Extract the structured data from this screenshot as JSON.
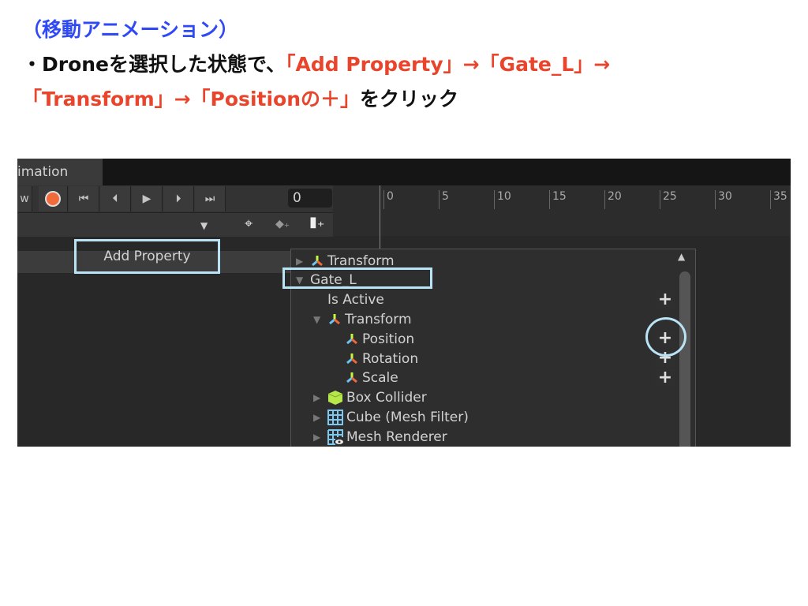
{
  "slide": {
    "heading": "（移動アニメーション）",
    "line2_black": "・Droneを選択した状態で、",
    "line2_red": "「Add Property」→「Gate_L」→",
    "line3_red": "「Transform」→「Positionの＋」",
    "line3_black": "をクリック"
  },
  "colors": {
    "heading": "#2f49f5",
    "highlight": "#e8452c",
    "callout": "#b8e4f5"
  },
  "window": {
    "tab": "imation",
    "preview_partial": "w",
    "frame": "0"
  },
  "toolbar": {
    "record": "record-icon",
    "first": "⏮",
    "prev": "⏴",
    "play": "▶",
    "next": "⏵",
    "last": "⏭"
  },
  "ruler": [
    "0",
    "5",
    "10",
    "15",
    "20",
    "25",
    "30",
    "35"
  ],
  "add_property": "Add Property",
  "popup": {
    "items": [
      {
        "label": "Transform",
        "indent": 0,
        "arrow": "▶",
        "icon": "transform-icon"
      },
      {
        "label": "Gate_L",
        "indent": 0,
        "arrow": "▼",
        "icon": ""
      },
      {
        "label": "Is Active",
        "indent": 1,
        "arrow": "",
        "icon": "",
        "plus": true
      },
      {
        "label": "Transform",
        "indent": 1,
        "arrow": "▼",
        "icon": "transform-icon"
      },
      {
        "label": "Position",
        "indent": 2,
        "arrow": "",
        "icon": "transform-icon",
        "plus": true
      },
      {
        "label": "Rotation",
        "indent": 2,
        "arrow": "",
        "icon": "transform-icon",
        "plus": true
      },
      {
        "label": "Scale",
        "indent": 2,
        "arrow": "",
        "icon": "transform-icon",
        "plus": true
      },
      {
        "label": "Box Collider",
        "indent": 1,
        "arrow": "▶",
        "icon": "box-collider-icon"
      },
      {
        "label": "Cube (Mesh Filter)",
        "indent": 1,
        "arrow": "▶",
        "icon": "mesh-filter-icon"
      },
      {
        "label": "Mesh Renderer",
        "indent": 1,
        "arrow": "▶",
        "icon": "mesh-renderer-icon"
      }
    ],
    "plus_label": "+"
  }
}
